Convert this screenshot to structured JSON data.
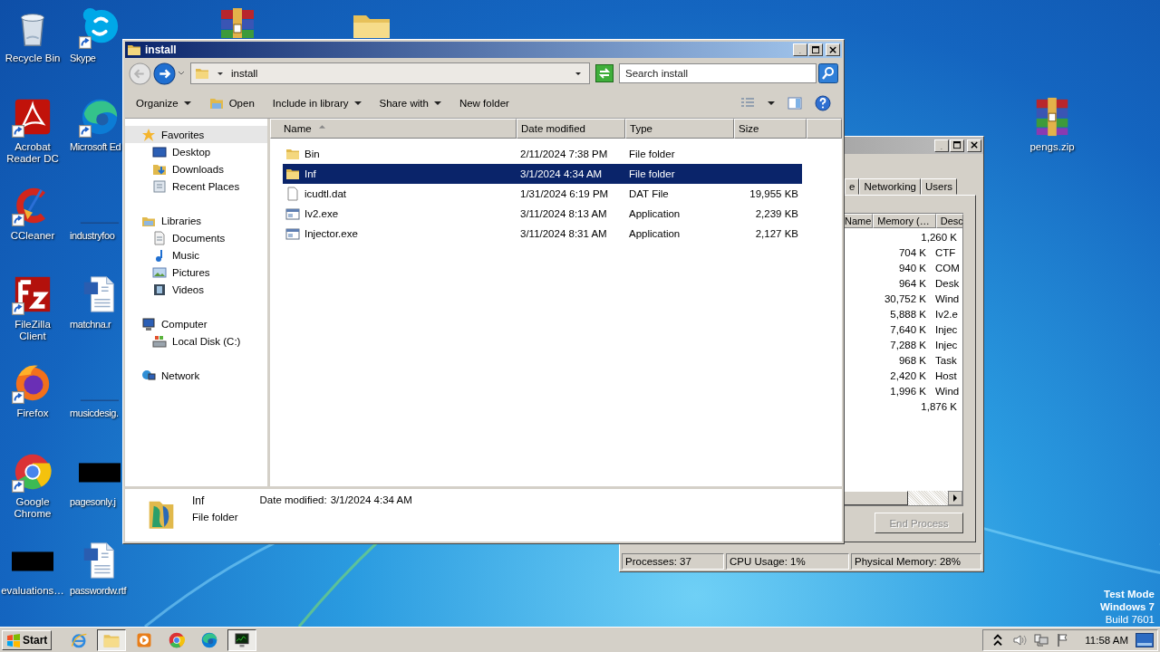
{
  "desktop": {
    "icons": [
      {
        "label": "Recycle Bin",
        "kind": "recycle",
        "shortcut": false
      },
      {
        "label": "Skype",
        "kind": "skype",
        "shortcut": true
      },
      {
        "label": "Acrobat Reader DC",
        "kind": "acrobat",
        "shortcut": true
      },
      {
        "label": "Microsoft Ed",
        "kind": "edge",
        "shortcut": true
      },
      {
        "label": "CCleaner",
        "kind": "ccleaner",
        "shortcut": true
      },
      {
        "label": "industryfoo",
        "kind": "blank",
        "shortcut": false
      },
      {
        "label": "FileZilla Client",
        "kind": "filezilla",
        "shortcut": true
      },
      {
        "label": "matchna.r",
        "kind": "word",
        "shortcut": false
      },
      {
        "label": "Firefox",
        "kind": "firefox",
        "shortcut": true
      },
      {
        "label": "musicdesig.",
        "kind": "blank",
        "shortcut": false
      },
      {
        "label": "Google Chrome",
        "kind": "chrome",
        "shortcut": true
      },
      {
        "label": "pagesonly.j",
        "kind": "thumb",
        "shortcut": false
      },
      {
        "label": "evaluations…",
        "kind": "thumb",
        "shortcut": false
      },
      {
        "label": "passwordw.rtf",
        "kind": "word",
        "shortcut": false
      }
    ],
    "top_icons": [
      {
        "kind": "archive"
      },
      {
        "kind": "folder"
      }
    ],
    "right_icons": [
      {
        "label": "pengs.zip",
        "kind": "archive"
      }
    ],
    "os_notice": [
      "Test Mode",
      "Windows 7",
      "Build 7601"
    ]
  },
  "explorer": {
    "title": "install",
    "address": "install",
    "search": {
      "placeholder": "Search install"
    },
    "toolbar": [
      {
        "label": "Organize",
        "dropdown": true,
        "kind": "plain"
      },
      {
        "label": "Open",
        "dropdown": false,
        "kind": "with_icon"
      },
      {
        "label": "Include in library",
        "dropdown": true,
        "kind": "plain"
      },
      {
        "label": "Share with",
        "dropdown": true,
        "kind": "plain"
      },
      {
        "label": "New folder",
        "dropdown": false,
        "kind": "plain"
      }
    ],
    "nav": [
      {
        "label": "Favorites",
        "kind": "star",
        "selected": true,
        "children": [
          {
            "label": "Desktop",
            "kind": "desktop",
            "selected": false
          },
          {
            "label": "Downloads",
            "kind": "downloads",
            "selected": false
          },
          {
            "label": "Recent Places",
            "kind": "recent",
            "selected": false
          }
        ]
      },
      {
        "label": "Libraries",
        "kind": "libraries",
        "selected": false,
        "children": [
          {
            "label": "Documents",
            "kind": "documents",
            "selected": false
          },
          {
            "label": "Music",
            "kind": "music",
            "selected": false
          },
          {
            "label": "Pictures",
            "kind": "pictures",
            "selected": false
          },
          {
            "label": "Videos",
            "kind": "videos",
            "selected": false
          }
        ]
      },
      {
        "label": "Computer",
        "kind": "computer",
        "selected": false,
        "children": [
          {
            "label": "Local Disk (C:)",
            "kind": "disk",
            "selected": false
          }
        ]
      },
      {
        "label": "Network",
        "kind": "network",
        "selected": false
      }
    ],
    "columns": [
      "Name",
      "Date modified",
      "Type",
      "Size"
    ],
    "files": [
      {
        "name": "Bin",
        "date": "2/11/2024 7:38 PM",
        "type": "File folder",
        "kind": "folder",
        "selected": false
      },
      {
        "name": "Inf",
        "date": "3/1/2024 4:34 AM",
        "type": "File folder",
        "kind": "folder",
        "selected": true
      },
      {
        "name": "icudtl.dat",
        "date": "1/31/2024 6:19 PM",
        "type": "DAT File",
        "size": "19,955 KB",
        "kind": "file",
        "selected": false
      },
      {
        "name": "Iv2.exe",
        "date": "3/11/2024 8:13 AM",
        "type": "Application",
        "size": "2,239 KB",
        "kind": "exe",
        "selected": false
      },
      {
        "name": "Injector.exe",
        "date": "3/11/2024 8:31 AM",
        "type": "Application",
        "size": "2,127 KB",
        "kind": "exe",
        "selected": false
      }
    ],
    "details": {
      "name": "Inf",
      "label": "Date modified:",
      "value": "3/1/2024 4:34 AM",
      "type": "File folder"
    }
  },
  "task_manager": {
    "tabs": [
      {
        "label": "e",
        "selected": false
      },
      {
        "label": "Networking",
        "selected": false
      },
      {
        "label": "Users",
        "selected": false
      }
    ],
    "columns": [
      "Name",
      "Memory (…",
      "Desc"
    ],
    "processes": [
      {
        "memory": "1,260 K"
      },
      {
        "memory": "704 K",
        "description": "CTF"
      },
      {
        "memory": "940 K",
        "description": "COM"
      },
      {
        "memory": "964 K",
        "description": "Desk"
      },
      {
        "memory": "30,752 K",
        "description": "Wind"
      },
      {
        "memory": "5,888 K",
        "description": "Iv2.e"
      },
      {
        "memory": "7,640 K",
        "description": "Injec"
      },
      {
        "memory": "7,288 K",
        "description": "Injec"
      },
      {
        "memory": "968 K",
        "description": "Task"
      },
      {
        "memory": "2,420 K",
        "description": "Host"
      },
      {
        "memory": "1,996 K",
        "description": "Wind"
      },
      {
        "memory": "1,876 K"
      }
    ],
    "end_process": {
      "label": "End Process",
      "disabled": true
    },
    "status": [
      "Processes: 37",
      "CPU Usage: 1%",
      "Physical Memory: 28%"
    ]
  },
  "taskbar": {
    "start": "Start",
    "apps": [
      {
        "kind": "ie",
        "active": false
      },
      {
        "kind": "folder",
        "active": true
      },
      {
        "kind": "media",
        "active": false
      },
      {
        "kind": "chrome",
        "active": false
      },
      {
        "kind": "edge",
        "active": false
      },
      {
        "kind": "taskmgr",
        "active": true
      }
    ],
    "clock": "11:58 AM"
  }
}
